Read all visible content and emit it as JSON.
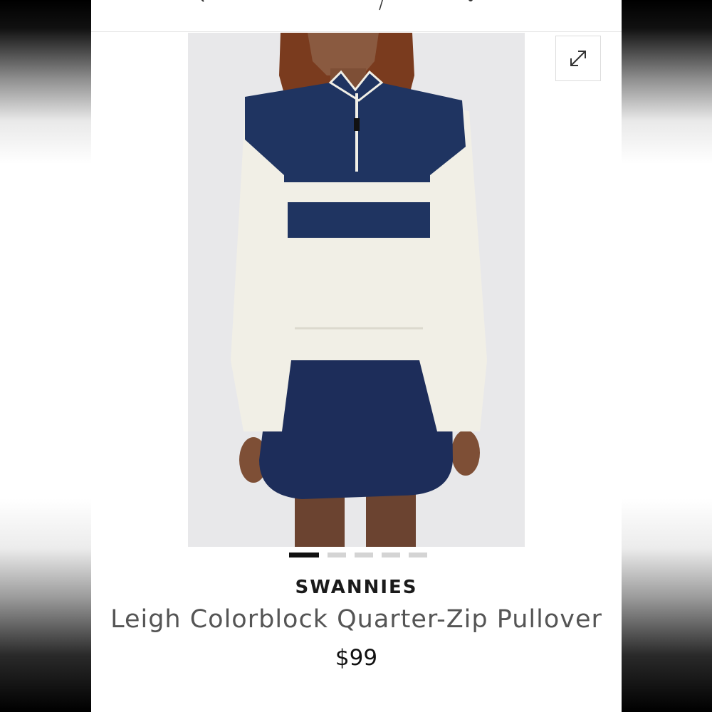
{
  "product": {
    "brand": "SWANNIES",
    "title": "Leigh Colorblock Quarter-Zip Pullover",
    "price": "$99"
  },
  "gallery": {
    "image_count": 5,
    "active_index": 0,
    "expand_icon": "expand-arrows-icon"
  },
  "colors": {
    "navy": "#1f3461",
    "cream": "#f1efe6",
    "image_background": "#e8e8ea",
    "pager_active": "#111111",
    "pager_inactive": "#d4d4d4"
  }
}
